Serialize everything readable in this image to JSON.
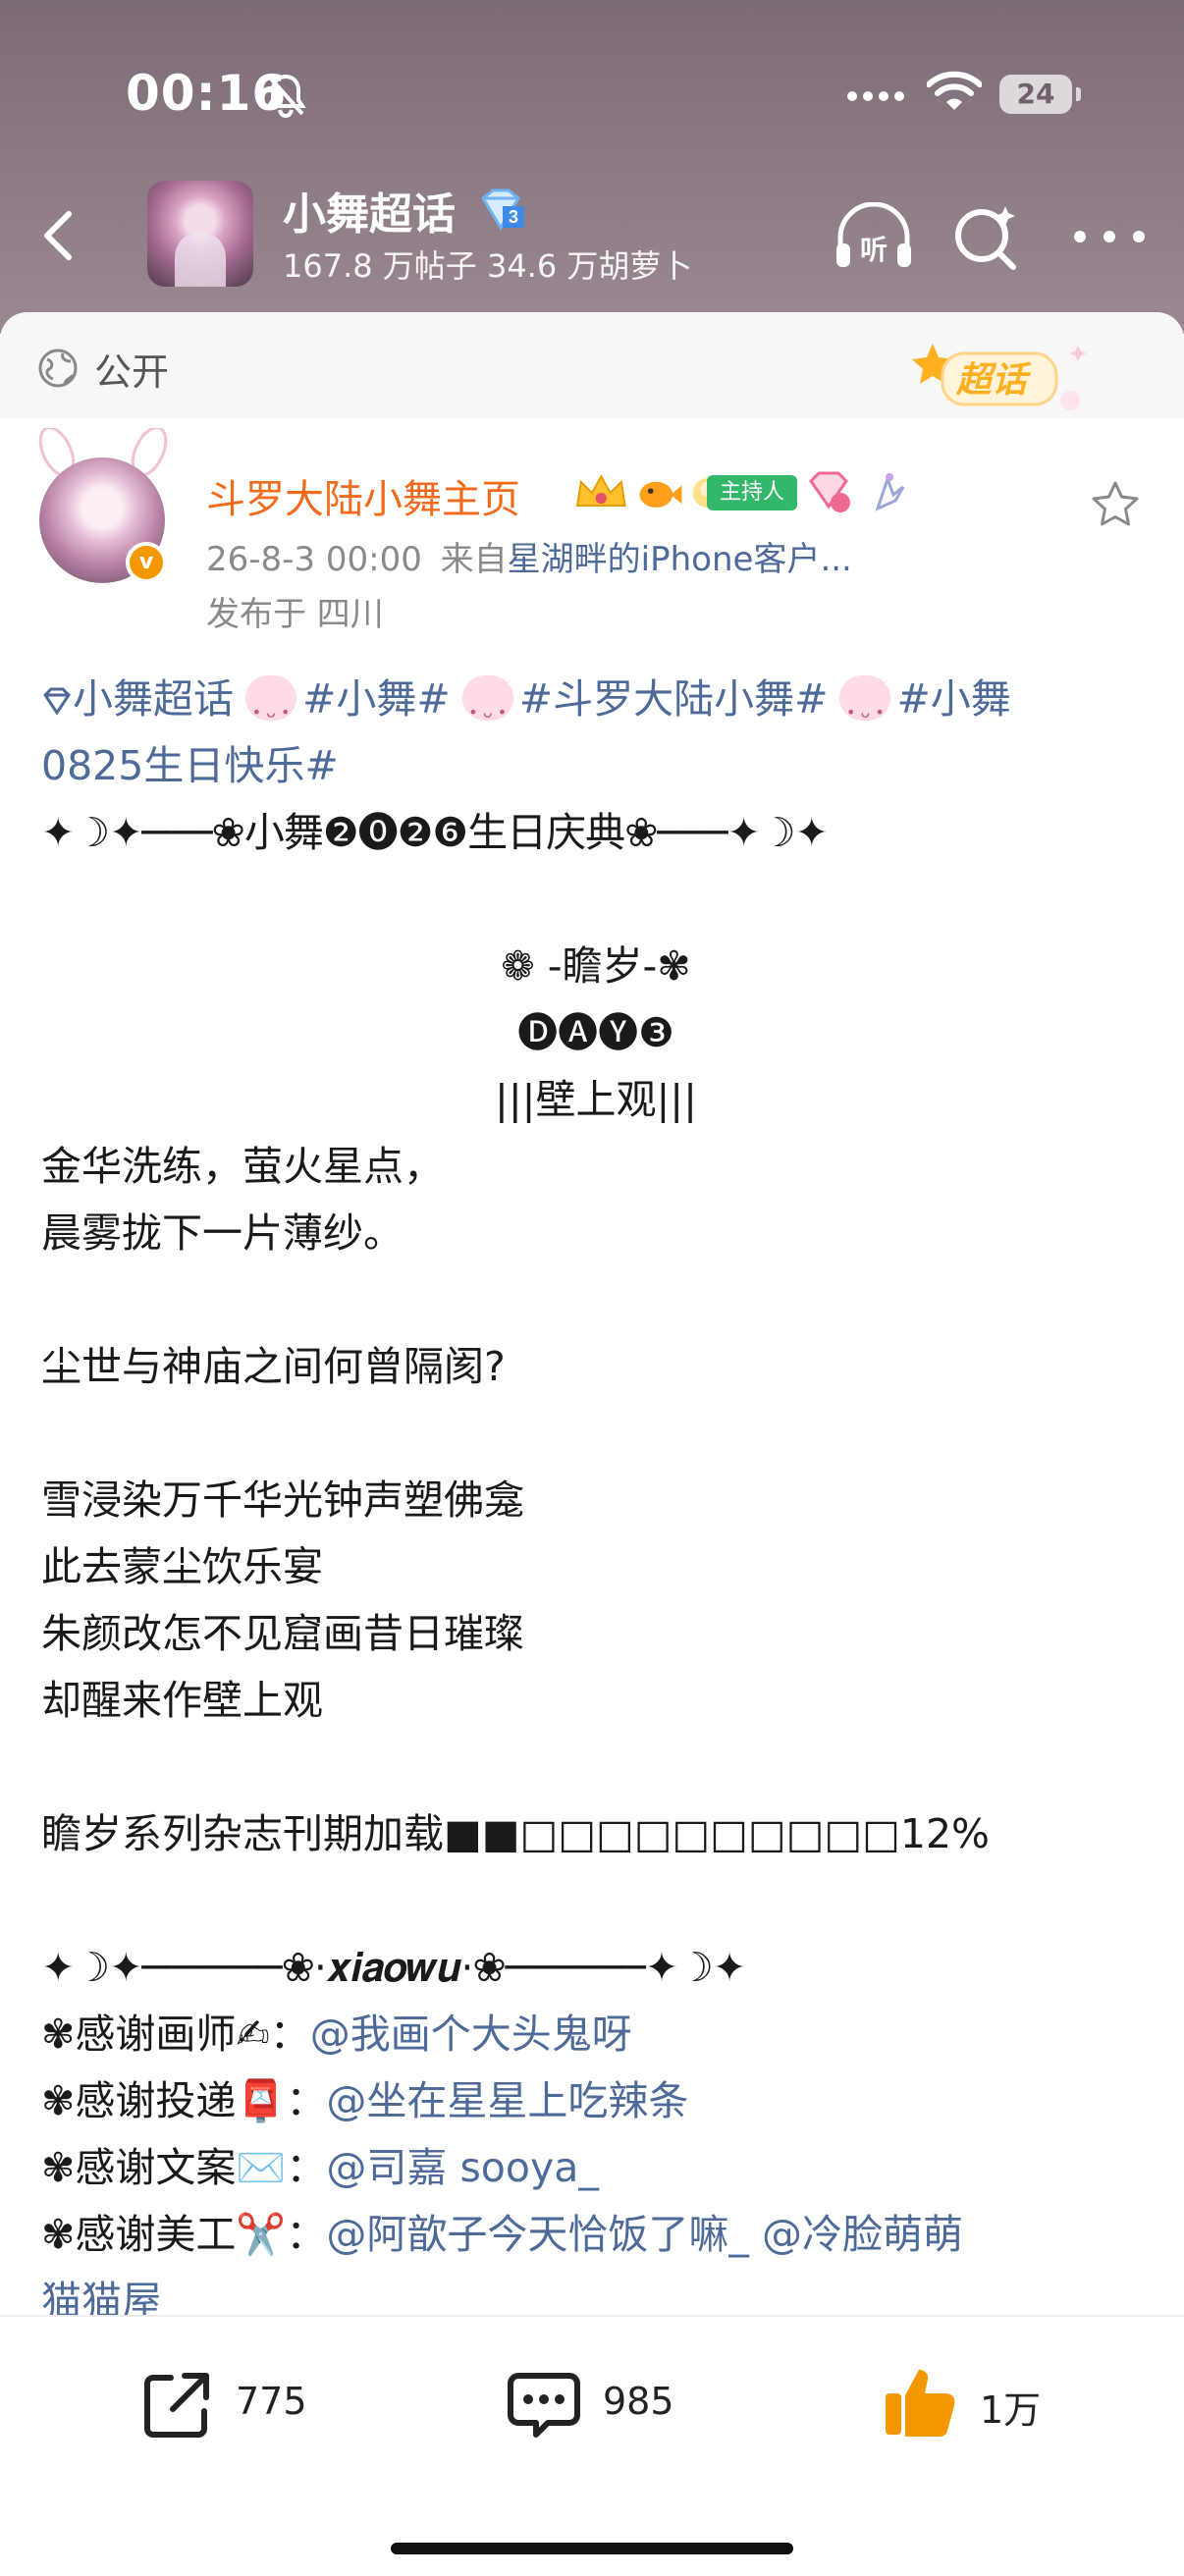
{
  "status_bar": {
    "time": "00:16",
    "battery": "24"
  },
  "nav": {
    "title": "小舞超话",
    "stats": "167.8 万帖子 34.6 万胡萝卜",
    "listen_label": "听"
  },
  "privacy": {
    "label": "公开",
    "supertopic_label": "超话"
  },
  "post": {
    "username": "斗罗大陆小舞主页",
    "host_badge": "主持人",
    "timestamp": "26-8-3 00:00",
    "from_prefix": "来自",
    "source": "星湖畔的iPhone客户...",
    "location": "发布于 四川",
    "vbadge": "v",
    "tags_line1": {
      "supertopic": "小舞超话",
      "tag1": "#小舞#",
      "tag2": "#斗罗大陆小舞#",
      "tag3a": "#小舞"
    },
    "tags_line2": "0825生日快乐#",
    "lines": {
      "divider1": "✦☽✦───❀小舞❷⓿❷❻生日庆典❀───✦☽✦",
      "title1": "❁ -瞻岁-✾",
      "title2": "🅓🅐🅨❸",
      "title3": "|||壁上观|||",
      "p1": "金华洗练，萤火星点，",
      "p2": "晨雾拢下一片薄纱。",
      "p3": "尘世与神庙之间何曾隔阂?",
      "p4": "雪浸染万千华光钟声塑佛龛",
      "p5": "此去蒙尘饮乐宴",
      "p6": "朱颜改怎不见窟画昔日璀璨",
      "p7": "却醒来作壁上观",
      "progress": "瞻岁系列杂志刊期加载■■□□□□□□□□□□12%",
      "divider2": "✦☽✦──────❀·𝒙𝒊𝒂𝒐𝒘𝒖·❀──────✦☽✦",
      "credit1_label": "✾感谢画师✍：",
      "credit1_mention": "@我画个大头鬼呀",
      "credit2_label": "✾感谢投递📮：",
      "credit2_mention": "@坐在星星上吃辣条",
      "credit3_label": "✾感谢文案✉️：",
      "credit3_mention": "@司嘉 sooya_",
      "credit4_label": "✾感谢美工✂️：",
      "credit4_mention": "@阿歆子今天恰饭了嘛_ @冷脸萌萌",
      "credit4_cont": "猫猫屋"
    }
  },
  "actions": {
    "repost_count": "775",
    "comment_count": "985",
    "like_count": "1万"
  },
  "colors": {
    "accent_orange": "#f26b1d",
    "link_blue": "#4e6a98",
    "like_orange": "#f39800"
  }
}
